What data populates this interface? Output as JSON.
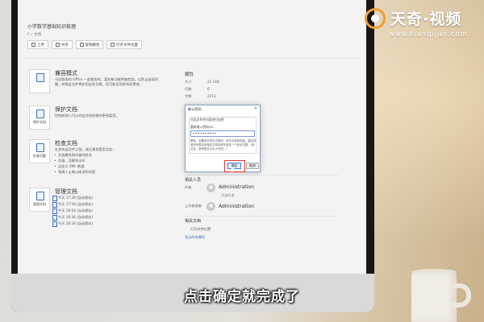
{
  "watermark": {
    "brand": "天奇·视频",
    "url": "www.tianqijun.com"
  },
  "caption": "点击确定就完成了",
  "document": {
    "title": "小学数学基础知识梳理",
    "path": "F » 文档",
    "toolbar": [
      {
        "label": "上传",
        "icon": "upload-icon"
      },
      {
        "label": "共享",
        "icon": "share-icon"
      },
      {
        "label": "复制路径",
        "icon": "copy-path-icon"
      },
      {
        "label": "打开文件位置",
        "icon": "folder-icon"
      }
    ]
  },
  "sections": {
    "compat": {
      "title": "兼容模式",
      "text": "与旧版本的 Office 一起使用时，某些新功能将被禁用，以防止出现问题。转换此文件将启用这些功能，但可能会导致布局更改。"
    },
    "protect": {
      "title": "保护文档",
      "icon_label": "保护文档",
      "text": "控制其他人可以对此文档所做的更改类型。"
    },
    "inspect": {
      "title": "检查文档",
      "icon_label": "检查问题",
      "text": "在发布此文件之前，请注意其是否包含：",
      "bullets": [
        "文档属性和作者的姓名",
        "页眉、页脚和水印",
        "自定义 XML 数据",
        "残障人士难以阅读的内容"
      ]
    },
    "manage": {
      "title": "管理文档",
      "icon_label": "管理文档",
      "versions": [
        "今天 17:39 (自动保存)",
        "今天 17:18 (自动保存)",
        "今天 16:54 (自动保存)",
        "今天 16:34 (自动保存)",
        "今天 16:24 (自动保存)"
      ]
    }
  },
  "properties": {
    "heading": "属性",
    "rows": [
      {
        "key": "大小",
        "value": "22.1KB"
      },
      {
        "key": "页数",
        "value": "6"
      },
      {
        "key": "字数",
        "value": "2213"
      }
    ]
  },
  "related_people": {
    "heading": "相关人员",
    "author_label": "作者",
    "author": "Administration",
    "add_author": "添加作者",
    "modifier_label": "上次修改者",
    "modifier": "Administration"
  },
  "related_docs": {
    "heading": "相关文档",
    "open_location": "打开文件位置",
    "show_all": "显示所有属性"
  },
  "dialog": {
    "title": "确认密码",
    "close": "×",
    "description": "对此文件的内容进行加密",
    "label": "重新输入密码(R):",
    "password": "••••••••••",
    "warning": "警告：如果丢失或忘记密码，则无法将其恢复。建议将密码列表及其相应文档名称存放在一个安全位置。(请记住，密码是区分大小写的。)",
    "ok": "确定",
    "cancel": "取消"
  }
}
